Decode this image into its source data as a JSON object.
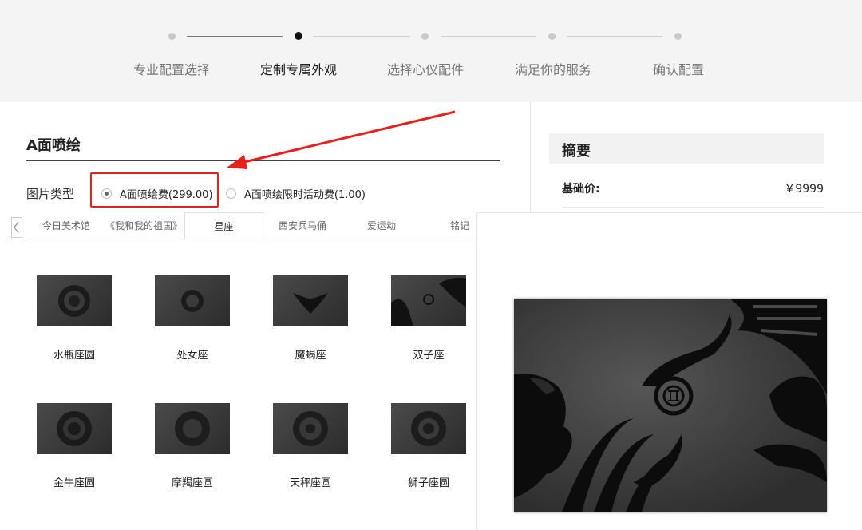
{
  "stepper": {
    "steps": [
      {
        "label": "专业配置选择",
        "active": false
      },
      {
        "label": "定制专属外观",
        "active": true
      },
      {
        "label": "选择心仪配件",
        "active": false
      },
      {
        "label": "满足你的服务",
        "active": false
      },
      {
        "label": "确认配置",
        "active": false
      }
    ]
  },
  "section": {
    "title": "A面喷绘",
    "type_label": "图片类型",
    "options": [
      {
        "label": "A面喷绘费(299.00)",
        "checked": true
      },
      {
        "label": "A面喷绘限时活动费(1.00)",
        "checked": false
      }
    ]
  },
  "tabs": [
    "今日美术馆",
    "《我和我的祖国》",
    "星座",
    "西安兵马俑",
    "爱运动",
    "铭记"
  ],
  "active_tab": "星座",
  "gallery": [
    {
      "label": "水瓶座圆"
    },
    {
      "label": "处女座"
    },
    {
      "label": "魔蝎座"
    },
    {
      "label": "双子座"
    },
    {
      "label": "金牛座圆"
    },
    {
      "label": "摩羯座圆"
    },
    {
      "label": "天秤座圆"
    },
    {
      "label": "狮子座圆"
    }
  ],
  "summary": {
    "title": "摘要",
    "base_price_label": "基础价:",
    "base_price_value": "￥9999"
  },
  "colors": {
    "accent_red": "#e8201c",
    "header_bg": "#f4f4f4"
  }
}
